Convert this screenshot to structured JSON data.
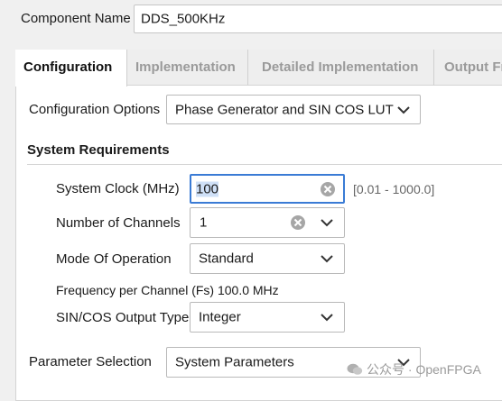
{
  "component": {
    "label": "Component Name",
    "value": "DDS_500KHz"
  },
  "tabs": [
    {
      "label": "Configuration"
    },
    {
      "label": "Implementation"
    },
    {
      "label": "Detailed Implementation"
    },
    {
      "label": "Output Fr"
    }
  ],
  "config_options": {
    "label": "Configuration Options",
    "value": "Phase Generator and SIN COS LUT"
  },
  "system_requirements": {
    "title": "System Requirements",
    "system_clock": {
      "label": "System Clock (MHz)",
      "value": "100",
      "range": "[0.01 - 1000.0]"
    },
    "channels": {
      "label": "Number of Channels",
      "value": "1"
    },
    "mode": {
      "label": "Mode Of Operation",
      "value": "Standard"
    },
    "frequency_text": "Frequency per Channel (Fs) 100.0 MHz",
    "output_type": {
      "label": "SIN/COS Output Type",
      "value": "Integer"
    }
  },
  "parameter_selection": {
    "label": "Parameter Selection",
    "value": "System Parameters"
  },
  "watermark": "公众号 · OpenFPGA"
}
